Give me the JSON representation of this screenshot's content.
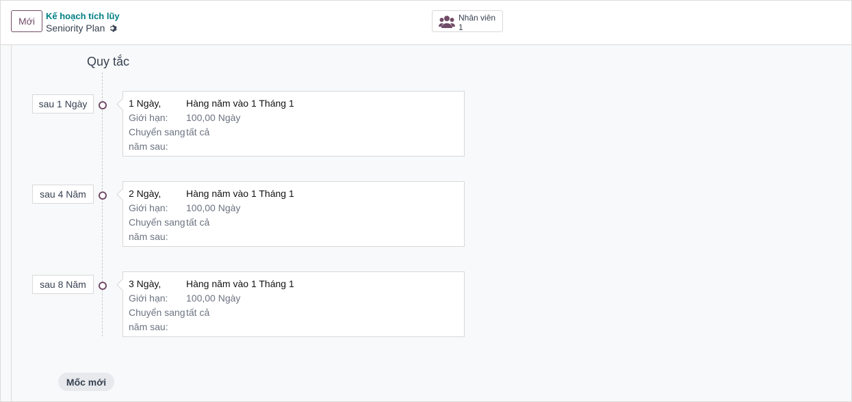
{
  "header": {
    "new_button": "Mới",
    "breadcrumb": "Kế hoạch tích lũy",
    "record_title": "Seniority Plan",
    "gear_icon": "gear-icon",
    "employees": {
      "label": "Nhân viên",
      "value": "1",
      "icon": "users-icon"
    }
  },
  "section": {
    "title": "Quy tắc"
  },
  "rules": [
    {
      "milestone": "sau 1 Ngày",
      "amount": "1 Ngày,",
      "frequency": "Hàng năm vào 1 Tháng 1",
      "cap_label": "Giới hạn:",
      "cap_value": "100,00 Ngày",
      "carry_label": "Chuyển sang",
      "carry_value": "tất cả",
      "next_year_label": "năm sau:"
    },
    {
      "milestone": "sau 4 Năm",
      "amount": "2 Ngày,",
      "frequency": "Hàng năm vào 1 Tháng 1",
      "cap_label": "Giới hạn:",
      "cap_value": "100,00 Ngày",
      "carry_label": "Chuyển sang",
      "carry_value": "tất cả",
      "next_year_label": "năm sau:"
    },
    {
      "milestone": "sau 8 Năm",
      "amount": "3 Ngày,",
      "frequency": "Hàng năm vào 1 Tháng 1",
      "cap_label": "Giới hạn:",
      "cap_value": "100,00 Ngày",
      "carry_label": "Chuyển sang",
      "carry_value": "tất cả",
      "next_year_label": "năm sau:"
    }
  ],
  "footer": {
    "new_milestone_button": "Mốc mới"
  },
  "colors": {
    "primary": "#714b67",
    "link": "#017e84",
    "background": "#f8f9fa"
  }
}
